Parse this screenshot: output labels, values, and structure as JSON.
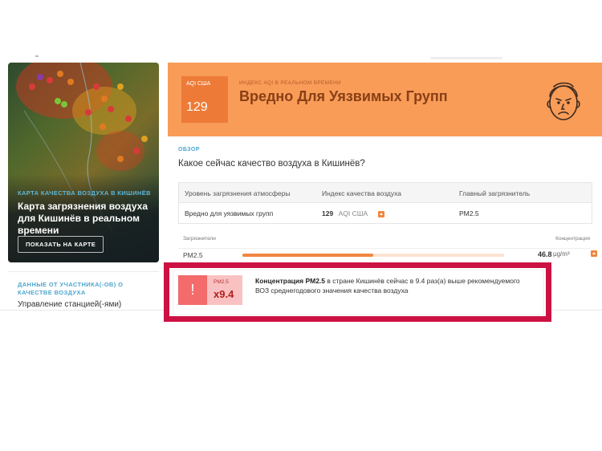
{
  "map_card": {
    "caption": "КАРТА КАЧЕСТВА ВОЗДУХА В КИШИНЁВ",
    "title": "Карта загрязнения воздуха для Кишинёв в реальном времени",
    "button": "ПОКАЗАТЬ НА КАРТЕ"
  },
  "contributors": {
    "caption": "ДАННЫЕ ОТ УЧАСТНИКА(-ОВ) О КАЧЕСТВЕ ВОЗДУХА",
    "manage": "Управление станцией(-ями)"
  },
  "banner": {
    "aqi_label": "AQI США",
    "aqi_value": "129",
    "realtime_caption": "ИНДЕКС AQI В РЕАЛЬНОМ ВРЕМЕНИ",
    "status": "Вредно Для Уязвимых Групп",
    "colors": {
      "banner": "#f89c58",
      "box": "#ed7b37",
      "text": "#8a3f16"
    }
  },
  "overview": {
    "caption": "ОБЗОР",
    "question": "Какое сейчас качество воздуха в Кишинёв?"
  },
  "table": {
    "headers": [
      "Уровень загрязнения атмосферы",
      "Индекс качества воздуха",
      "Главный загрязнитель"
    ],
    "level": "Вредно для уязвимых групп",
    "aqi_value": "129",
    "aqi_unit": "AQI США",
    "main_pollutant": "PM2.5"
  },
  "pollutants": {
    "caption": "Загрязнители",
    "concentration_caption": "Концентрация",
    "rows": [
      {
        "name": "PM2.5",
        "value": "46.8",
        "unit": "µg/m³",
        "level_fraction": 0.5
      }
    ]
  },
  "highlight": {
    "label": "PM2.5",
    "ratio": "x9.4",
    "bold_text": "Концентрация PM2.5",
    "text": " в стране Кишинёв сейчас в 9.4 раз(а) выше рекомендуемого ВОЗ среднегодового значения качества воздуха",
    "border_color": "#cc1143"
  }
}
